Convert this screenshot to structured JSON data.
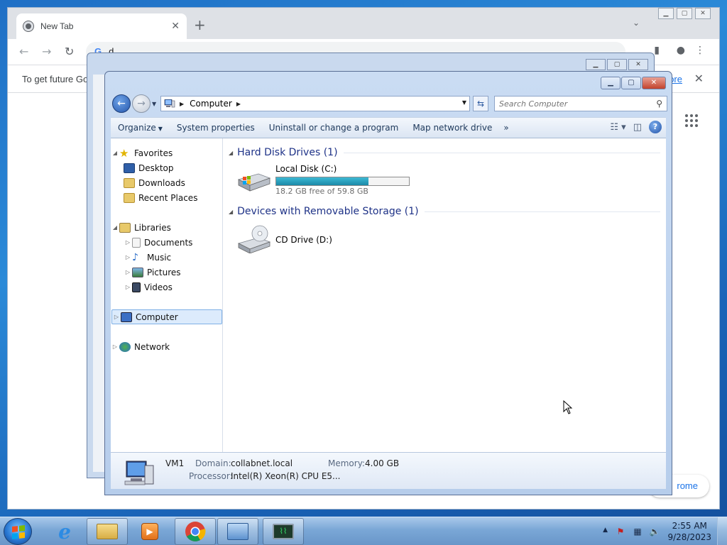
{
  "chrome": {
    "tab_title": "New Tab",
    "omnibox_text": "d",
    "infobar_text": "To get future Go",
    "infobar_link": "ore",
    "customize_label": "rome"
  },
  "explorer": {
    "address_segments": [
      "Computer"
    ],
    "search_placeholder": "Search Computer",
    "commands": [
      "Organize",
      "System properties",
      "Uninstall or change a program",
      "Map network drive"
    ],
    "overflow": "»",
    "nav": {
      "favorites": "Favorites",
      "favorites_items": [
        "Desktop",
        "Downloads",
        "Recent Places"
      ],
      "libraries": "Libraries",
      "libraries_items": [
        "Documents",
        "Music",
        "Pictures",
        "Videos"
      ],
      "computer": "Computer",
      "network": "Network"
    },
    "groups": {
      "hdd_title": "Hard Disk Drives (1)",
      "removable_title": "Devices with Removable Storage (1)"
    },
    "drives": {
      "c_name": "Local Disk (C:)",
      "c_free": "18.2 GB free of 59.8 GB",
      "c_used_fraction": 0.6957,
      "d_name": "CD Drive (D:)"
    },
    "details": {
      "name": "VM1",
      "domain_label": "Domain:",
      "domain_value": "collabnet.local",
      "memory_label": "Memory:",
      "memory_value": "4.00 GB",
      "processor_label": "Processor:",
      "processor_value": "Intel(R) Xeon(R) CPU E5..."
    }
  },
  "taskbar": {
    "time": "2:55 AM",
    "date": "9/28/2023"
  }
}
